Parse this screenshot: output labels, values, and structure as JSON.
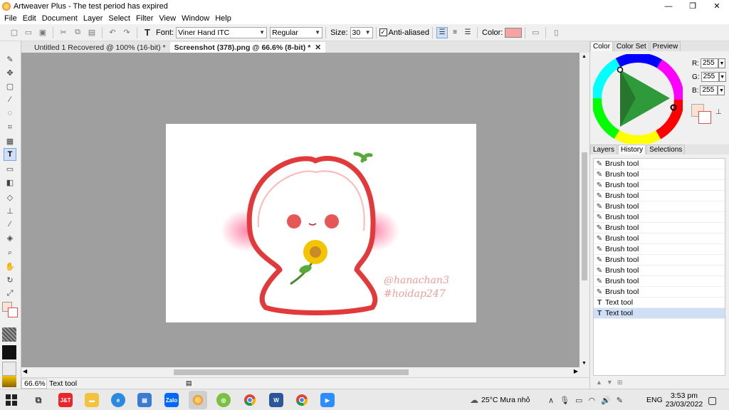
{
  "window": {
    "title": "Artweaver Plus - The test period has expired",
    "minimize": "—",
    "restore": "❐",
    "close": "✕"
  },
  "menu": [
    "File",
    "Edit",
    "Document",
    "Layer",
    "Select",
    "Filter",
    "View",
    "Window",
    "Help"
  ],
  "toolbar": {
    "font_label": "Font:",
    "font_value": "Viner Hand ITC",
    "style_value": "Regular",
    "size_label": "Size:",
    "size_value": "30",
    "anti_aliased_label": "Anti-aliased",
    "anti_aliased_checked": true,
    "color_label": "Color:",
    "color_value": "#f5a3a3"
  },
  "document_tabs": [
    {
      "label": "Untitled 1 Recovered @ 100% (16-bit) *",
      "active": false
    },
    {
      "label": "Screenshot (378).png @ 66.6% (8-bit) *",
      "active": true,
      "close": "✕"
    }
  ],
  "canvas": {
    "watermark_line1": "@hanachan3",
    "watermark_line2": "#hoidap247"
  },
  "status": {
    "zoom": "66.6%",
    "tool": "Text tool"
  },
  "right_panel": {
    "top_tabs": [
      "Color",
      "Color Set",
      "Preview"
    ],
    "rgb": [
      {
        "label": "R:",
        "value": "255"
      },
      {
        "label": "G:",
        "value": "255"
      },
      {
        "label": "B:",
        "value": "255"
      }
    ],
    "primary_color": "#fde2d2",
    "secondary_color": "#ffffff",
    "bottom_tabs": [
      "Layers",
      "History",
      "Selections"
    ],
    "history": [
      {
        "label": "Brush tool",
        "icon": "brush-icon"
      },
      {
        "label": "Brush tool",
        "icon": "brush-icon"
      },
      {
        "label": "Brush tool",
        "icon": "brush-icon"
      },
      {
        "label": "Brush tool",
        "icon": "brush-icon"
      },
      {
        "label": "Brush tool",
        "icon": "brush-icon"
      },
      {
        "label": "Brush tool",
        "icon": "brush-icon"
      },
      {
        "label": "Brush tool",
        "icon": "brush-icon"
      },
      {
        "label": "Brush tool",
        "icon": "brush-icon"
      },
      {
        "label": "Brush tool",
        "icon": "brush-icon"
      },
      {
        "label": "Brush tool",
        "icon": "brush-icon"
      },
      {
        "label": "Brush tool",
        "icon": "brush-icon"
      },
      {
        "label": "Brush tool",
        "icon": "brush-icon"
      },
      {
        "label": "Brush tool",
        "icon": "brush-icon"
      },
      {
        "label": "Text tool",
        "icon": "text-tool-icon"
      },
      {
        "label": "Text tool",
        "icon": "text-tool-icon",
        "selected": true
      }
    ]
  },
  "taskbar": {
    "weather": "25°C  Mưa nhỏ",
    "language": "ENG",
    "time": "3:53 pm",
    "date": "23/03/2022",
    "zalo": "Zalo"
  }
}
